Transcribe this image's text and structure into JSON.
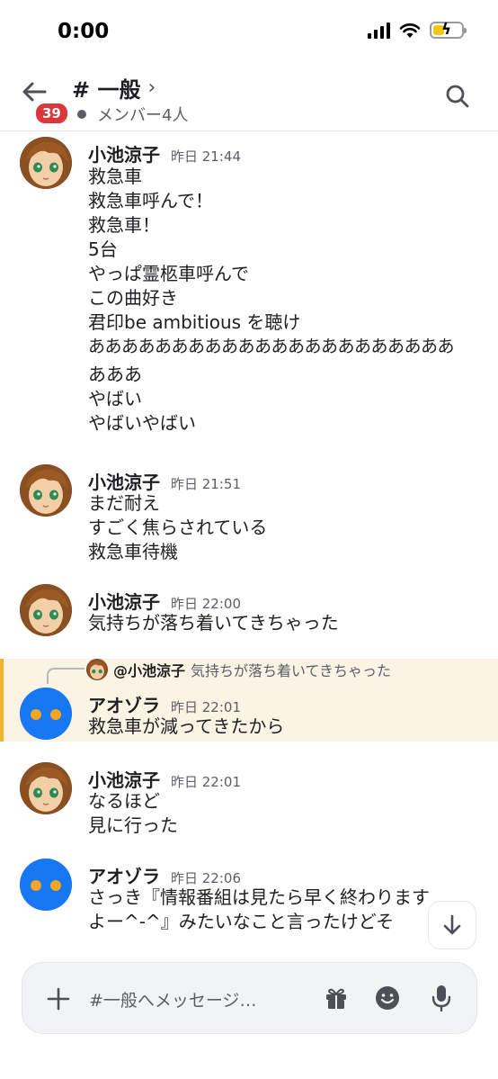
{
  "status_bar": {
    "time": "0:00"
  },
  "header": {
    "channel_name": "# 一般",
    "chevron": "›",
    "unread_badge": "39",
    "members": "メンバー4人",
    "icons": {
      "back": "arrow-left-icon",
      "search": "search-icon"
    }
  },
  "messages": [
    {
      "author": "小池涼子",
      "time": "昨日 21:44",
      "avatar": "anime-girl-avatar",
      "lines": [
        "救急車",
        "救急車呼んで！",
        "救急車！",
        "5台",
        "やっぱ霊柩車呼んで",
        "この曲好き",
        "君印be ambitious を聴け",
        "ああああああああああああああああああああああ",
        "あああ",
        "やばい",
        "やばいやばい"
      ]
    },
    {
      "author": "小池涼子",
      "time": "昨日 21:51",
      "avatar": "anime-girl-avatar",
      "lines": [
        "まだ耐え",
        "すごく焦らされている",
        "救急車待機"
      ]
    },
    {
      "author": "小池涼子",
      "time": "昨日 22:00",
      "avatar": "anime-girl-avatar",
      "lines": [
        "気持ちが落ち着いてきちゃった"
      ]
    },
    {
      "author": "アオゾラ",
      "time": "昨日 22:01",
      "avatar": "blue-face-avatar",
      "reply": {
        "name": "@小池涼子",
        "text": "気持ちが落ち着いてきちゃった"
      },
      "lines": [
        "救急車が減ってきたから"
      ]
    },
    {
      "author": "小池涼子",
      "time": "昨日 22:01",
      "avatar": "anime-girl-avatar",
      "lines": [
        "なるほど",
        "見に行った"
      ]
    },
    {
      "author": "アオゾラ",
      "time": "昨日 22:06",
      "avatar": "blue-face-avatar",
      "lines": [
        "さっき『情報番組は見たら早く終わります",
        "よー^-^』みたいなこと言ったけどそ"
      ]
    }
  ],
  "composer": {
    "placeholder": "#一般へメッセージ…",
    "icons": {
      "add": "plus-icon",
      "gift": "gift-icon",
      "emoji": "emoji-icon",
      "mic": "microphone-icon"
    }
  },
  "colors": {
    "accent_red": "#da373c",
    "highlight_bg": "#fbf3e4",
    "highlight_bar": "#f0b232",
    "blue_avatar": "#1877f2"
  }
}
